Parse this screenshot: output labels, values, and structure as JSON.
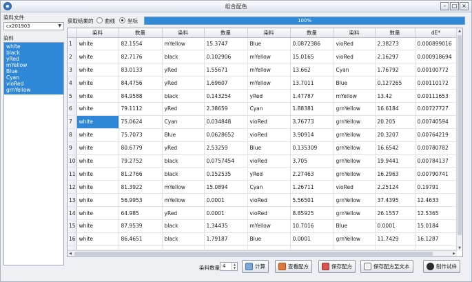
{
  "window": {
    "title": "组合配色"
  },
  "left_panel": {
    "file_label": "染料文件",
    "file_value": "cx201903",
    "dye_label": "染料",
    "dyes": [
      "white",
      "black",
      "yRed",
      "mYellow",
      "Blue",
      "Cyan",
      "vioRed",
      "grnYellow"
    ]
  },
  "controls": {
    "label": "获取结果的",
    "option_curve": "曲线",
    "option_coord": "坐标",
    "selected": "坐标",
    "progress_text": "100%",
    "progress_value": 1.0
  },
  "table": {
    "headers": [
      "",
      "染料",
      "数量",
      "染料",
      "数量",
      "染料",
      "数量",
      "染料",
      "数量",
      "dE*"
    ],
    "rows": [
      [
        "1",
        "white",
        "82.1554",
        "mYellow",
        "15.3747",
        "Blue",
        "0.0872386",
        "vioRed",
        "2.38273",
        "0.000899016"
      ],
      [
        "2",
        "white",
        "82.7176",
        "black",
        "0.102906",
        "mYellow",
        "15.0165",
        "vioRed",
        "2.16297",
        "0.000918694"
      ],
      [
        "3",
        "white",
        "83.0133",
        "yRed",
        "1.55671",
        "mYellow",
        "13.662",
        "Cyan",
        "1.76792",
        "0.00100772"
      ],
      [
        "4",
        "white",
        "84.4756",
        "yRed",
        "1.69607",
        "mYellow",
        "13.7011",
        "Blue",
        "0.127265",
        "0.00110172"
      ],
      [
        "5",
        "white",
        "84.9588",
        "black",
        "0.143254",
        "yRed",
        "1.47787",
        "mYellow",
        "13.42",
        "0.00111653"
      ],
      [
        "6",
        "white",
        "79.1112",
        "yRed",
        "2.38659",
        "Cyan",
        "1.88381",
        "grnYellow",
        "16.6184",
        "0.00727727"
      ],
      [
        "7",
        "white",
        "75.0624",
        "Cyan",
        "0.034848",
        "vioRed",
        "3.76773",
        "grnYellow",
        "20.205",
        "0.00740594"
      ],
      [
        "8",
        "white",
        "75.7073",
        "Blue",
        "0.0628652",
        "vioRed",
        "3.90914",
        "grnYellow",
        "20.3207",
        "0.00764219"
      ],
      [
        "9",
        "white",
        "80.6779",
        "yRed",
        "2.53259",
        "Blue",
        "0.135309",
        "grnYellow",
        "16.6542",
        "0.00780782"
      ],
      [
        "10",
        "white",
        "79.2752",
        "black",
        "0.0757454",
        "vioRed",
        "3.705",
        "grnYellow",
        "19.9441",
        "0.00784137"
      ],
      [
        "11",
        "white",
        "81.2766",
        "black",
        "0.152535",
        "yRed",
        "2.27463",
        "grnYellow",
        "16.2963",
        "0.00790741"
      ],
      [
        "12",
        "white",
        "81.3922",
        "mYellow",
        "15.0894",
        "Cyan",
        "1.26711",
        "vioRed",
        "2.25124",
        "0.19791"
      ],
      [
        "13",
        "white",
        "56.9953",
        "mYellow",
        "0.0001",
        "vioRed",
        "5.56501",
        "grnYellow",
        "37.4395",
        "12.4633"
      ],
      [
        "14",
        "white",
        "64.985",
        "yRed",
        "0.0001",
        "vioRed",
        "8.85925",
        "grnYellow",
        "26.1557",
        "12.5365"
      ],
      [
        "15",
        "white",
        "87.9539",
        "black",
        "1.34435",
        "mYellow",
        "10.7016",
        "Blue",
        "0.0001",
        "15.0184"
      ],
      [
        "16",
        "white",
        "86.4651",
        "black",
        "1.79187",
        "Blue",
        "0.0001",
        "grnYellow",
        "11.7429",
        "16.1287"
      ]
    ],
    "selected_cell": {
      "row": 7,
      "col": 1
    }
  },
  "bottom_bar": {
    "count_label": "染料数量",
    "count_value": "4",
    "btn_calc": "计算",
    "btn_view": "查看配方",
    "btn_save": "保存配方",
    "btn_save_text": "保存配方至文本",
    "btn_make": "制作试样"
  }
}
